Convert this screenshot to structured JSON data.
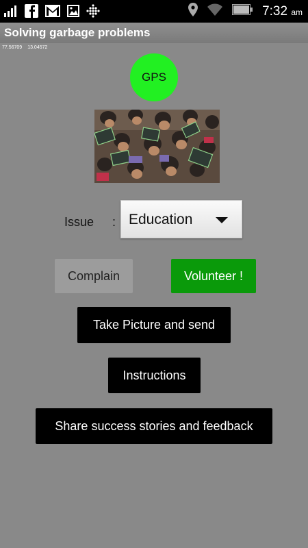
{
  "status_bar": {
    "time": "7:32",
    "ampm": "am",
    "icons": [
      "signal-icon",
      "facebook-icon",
      "gmail-icon",
      "gallery-icon",
      "apps-grid-icon",
      "location-icon",
      "wifi-icon",
      "battery-icon"
    ]
  },
  "app": {
    "title": "Solving garbage problems"
  },
  "coords": {
    "longitude": "77.56709",
    "latitude": "13.04572"
  },
  "gps": {
    "label": "GPS",
    "color": "#22f022"
  },
  "image": {
    "subject": "photo-children-with-slates"
  },
  "issue": {
    "label": "Issue",
    "separator": ":",
    "selected": "Education"
  },
  "buttons": {
    "complain": "Complain",
    "volunteer": "Volunteer !",
    "take_picture": "Take Picture and send",
    "instructions": "Instructions",
    "share": "Share success stories and feedback"
  },
  "colors": {
    "background": "#898989",
    "volunteer": "#0a9a0a",
    "complain": "#9c9c9c"
  }
}
